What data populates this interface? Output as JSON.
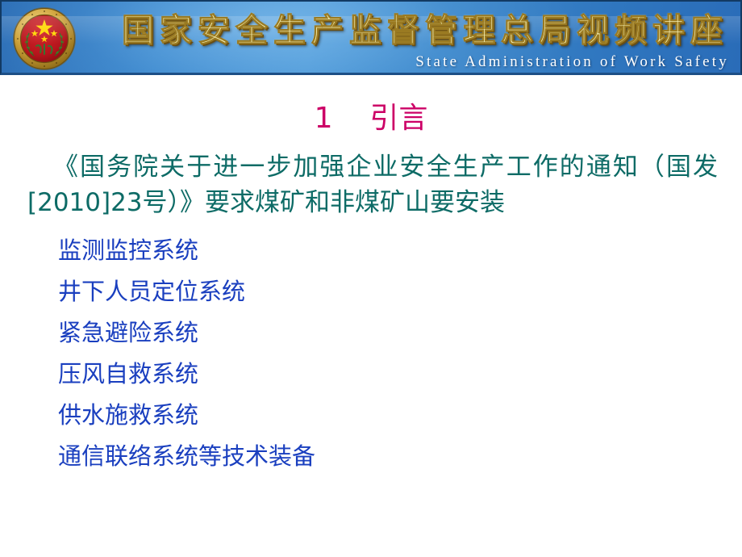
{
  "banner": {
    "emblem_name": "state-administration-of-work-safety-emblem",
    "title": "国家安全生产监督管理总局视频讲座",
    "subtitle": "State Administration of Work Safety",
    "colors": {
      "background_blue": "#3a86cc",
      "border_navy": "#123a63",
      "title_gold": "#f7f2b4",
      "title_outline": "#9a7a22",
      "subtitle_white": "#ffffff",
      "emblem_red": "#c0141b",
      "emblem_gold": "#d9a93a",
      "emblem_star_yellow": "#ffd700"
    }
  },
  "slide": {
    "heading": "1    引言",
    "heading_color": "#cc0066",
    "paragraph": "《国务院关于进一步加强企业安全生产工作的通知（国发[2010]23号）》要求煤矿和非煤矿山要安装",
    "paragraph_color": "#0d6b66",
    "list_color": "#1a3fbf",
    "background_color": "#ffffff",
    "items": [
      {
        "label": "监测监控系统"
      },
      {
        "label": "井下人员定位系统"
      },
      {
        "label": "紧急避险系统"
      },
      {
        "label": "压风自救系统"
      },
      {
        "label": "供水施救系统"
      },
      {
        "label": "通信联络系统等技术装备"
      }
    ]
  }
}
